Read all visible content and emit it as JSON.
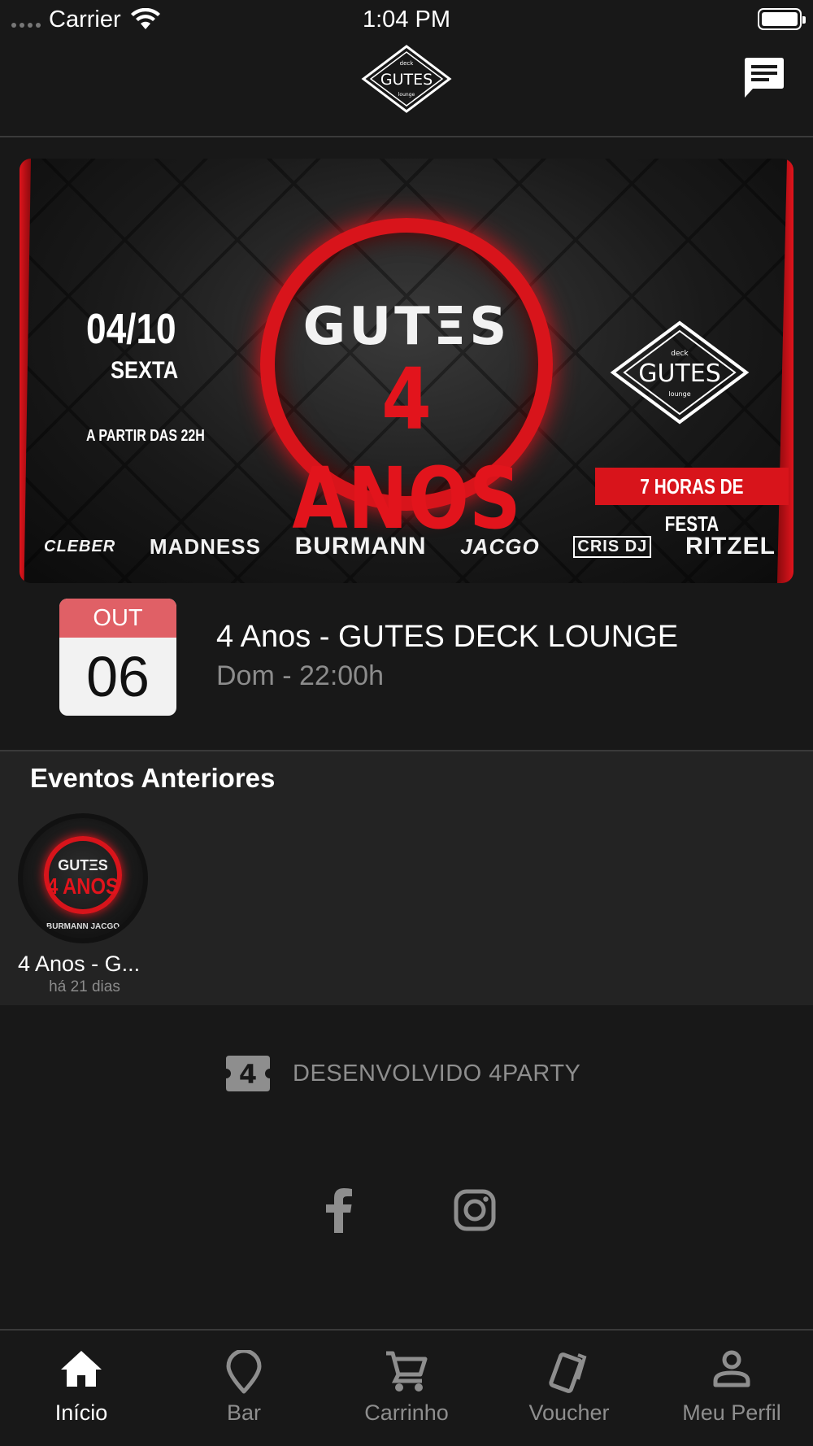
{
  "status_bar": {
    "carrier": "Carrier",
    "time": "1:04 PM"
  },
  "header": {
    "logo_text": "GUTES",
    "logo_top_text": "deck",
    "logo_bottom_text": "lounge",
    "chat_icon": "chat-icon"
  },
  "banner": {
    "date": "04/10",
    "weekday": "SEXTA",
    "start": "A PARTIR DAS 22H",
    "ring_title": "GUTΞS",
    "ring_subtitle": "4 ANOS",
    "tag": "7 HORAS DE FESTA",
    "artists": [
      "CLEBER",
      "MADNESS",
      "BURMANN",
      "JACGO",
      "CRIS DJ",
      "RITZEL"
    ],
    "accent_color": "#d8141b"
  },
  "event": {
    "month": "OUT",
    "day": "06",
    "title": "4 Anos - GUTES DECK LOUNGE",
    "subtitle": "Dom - 22:00h"
  },
  "past_events": {
    "heading": "Eventos Anteriores",
    "items": [
      {
        "name": "4 Anos - G...",
        "time": "há 21 dias",
        "thumb_line1": "GUTΞS",
        "thumb_line2": "4 ANOS",
        "thumb_line3": "BURMANN   JACGO"
      }
    ]
  },
  "footer": {
    "dev_badge": "4",
    "dev_text": "DESENVOLVIDO 4PARTY",
    "social": [
      "facebook-icon",
      "instagram-icon"
    ]
  },
  "tabs": [
    {
      "label": "Início",
      "icon": "home-icon",
      "active": true
    },
    {
      "label": "Bar",
      "icon": "pin-icon",
      "active": false
    },
    {
      "label": "Carrinho",
      "icon": "cart-icon",
      "active": false
    },
    {
      "label": "Voucher",
      "icon": "voucher-icon",
      "active": false
    },
    {
      "label": "Meu Perfil",
      "icon": "person-icon",
      "active": false
    }
  ]
}
